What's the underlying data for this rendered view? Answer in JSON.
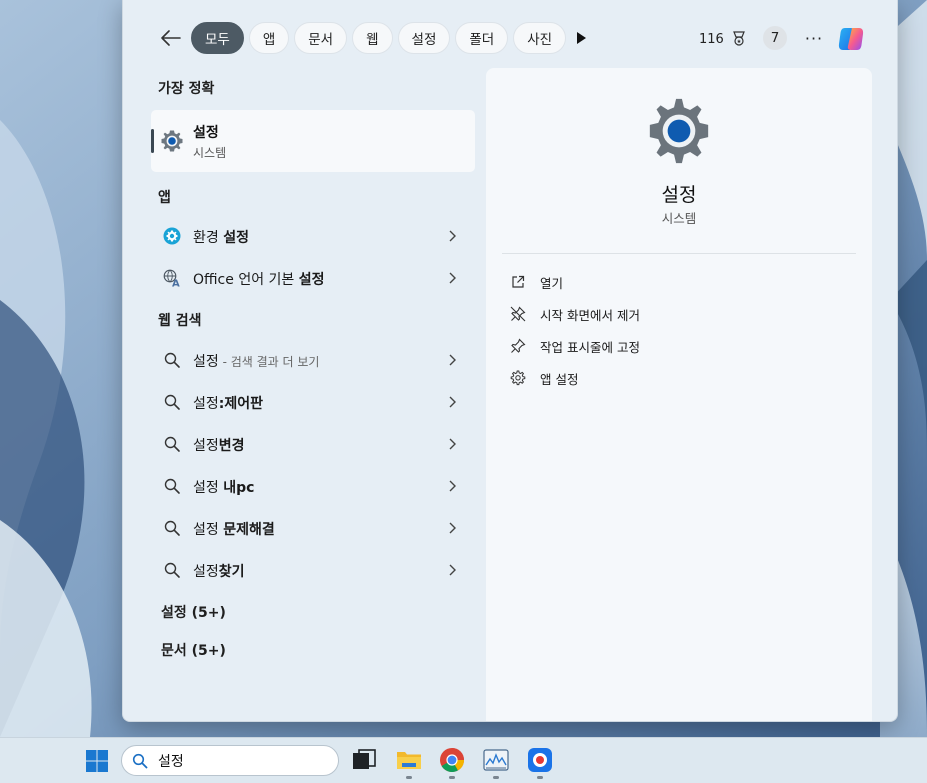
{
  "topbar": {
    "filters": [
      "모두",
      "앱",
      "문서",
      "웹",
      "설정",
      "폴더",
      "사진"
    ],
    "points": "116",
    "badge": "7",
    "more_label": "···"
  },
  "left": {
    "best_match_heading": "가장 정확",
    "best_match": {
      "title": "설정",
      "subtitle": "시스템"
    },
    "apps_heading": "앱",
    "apps": [
      {
        "prefix": "환경 ",
        "bold": "설정"
      },
      {
        "prefix": "Office 언어 기본 ",
        "bold": "설정"
      }
    ],
    "web_heading": "웹 검색",
    "web": [
      {
        "prefix": "설정",
        "bold": "",
        "sub": " - 검색 결과 더 보기"
      },
      {
        "prefix": "설정",
        "bold": ":제어판",
        "sub": ""
      },
      {
        "prefix": "설정",
        "bold": "변경",
        "sub": ""
      },
      {
        "prefix": "설정 ",
        "bold": "내pc",
        "sub": ""
      },
      {
        "prefix": "설정 ",
        "bold": "문제해결",
        "sub": ""
      },
      {
        "prefix": "설정",
        "bold": "찾기",
        "sub": ""
      }
    ],
    "settings_more": "설정 (5+)",
    "docs_more": "문서 (5+)"
  },
  "preview": {
    "title": "설정",
    "subtitle": "시스템",
    "actions": [
      "열기",
      "시작 화면에서 제거",
      "작업 표시줄에 고정",
      "앱 설정"
    ]
  },
  "taskbar": {
    "search_value": "설정"
  },
  "colors": {
    "active_pill": "#4d5a64",
    "gear_blue": "#0f5bb0",
    "panel_bg": "#e6eef5"
  }
}
